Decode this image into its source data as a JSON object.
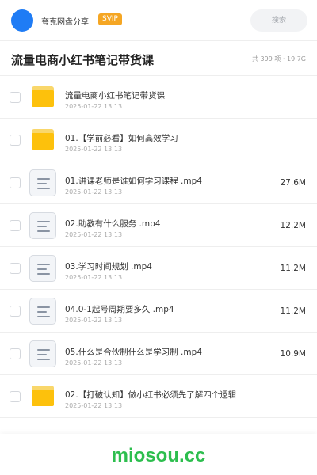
{
  "header": {
    "username": "夸克网盘分享",
    "badge": "SVIP",
    "search_placeholder": "搜索"
  },
  "folder": {
    "title": "流量电商小红书笔记带货课",
    "meta": "共 399 项 · 19.7G"
  },
  "items": [
    {
      "type": "folder",
      "name": "流量电商小红书笔记带货课",
      "date": "2025-01-22 13:13",
      "size": ""
    },
    {
      "type": "folder",
      "name": "01.【学前必看】如何高效学习",
      "date": "2025-01-22 13:13",
      "size": ""
    },
    {
      "type": "file",
      "name": "01.讲课老师是谁如何学习课程 .mp4",
      "date": "2025-01-22 13:13",
      "size": "27.6M"
    },
    {
      "type": "file",
      "name": "02.助教有什么服务 .mp4",
      "date": "2025-01-22 13:13",
      "size": "12.2M"
    },
    {
      "type": "file",
      "name": "03.学习时间规划 .mp4",
      "date": "2025-01-22 13:13",
      "size": "11.2M"
    },
    {
      "type": "file",
      "name": "04.0-1起号周期要多久 .mp4",
      "date": "2025-01-22 13:13",
      "size": "11.2M"
    },
    {
      "type": "file",
      "name": "05.什么是合伙制什么是学习制 .mp4",
      "date": "2025-01-22 13:13",
      "size": "10.9M"
    },
    {
      "type": "folder",
      "name": "02.【打破认知】做小红书必须先了解四个逻辑",
      "date": "2025-01-22 13:13",
      "size": ""
    }
  ],
  "watermark": "miosou.cc",
  "colors": {
    "accent": "#1f7cf5",
    "badge": "#f5a623",
    "folder": "#fdc10c",
    "watermark": "#2dbe4e"
  }
}
